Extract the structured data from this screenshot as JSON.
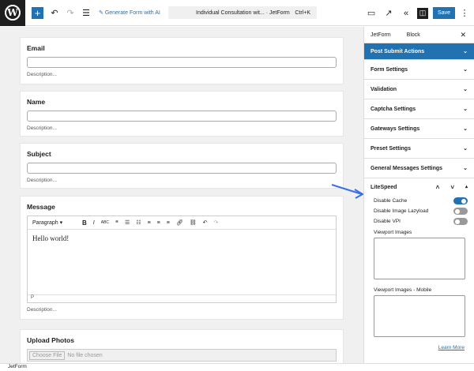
{
  "toolbar": {
    "generate": "Generate Form with AI",
    "doc_title": "Individual Consultation wit...",
    "post_type": "· JetForm",
    "shortcut": "Ctrl+K",
    "save": "Save"
  },
  "fields": [
    {
      "label": "Email",
      "description": "Description..."
    },
    {
      "label": "Name",
      "description": "Description..."
    },
    {
      "label": "Subject",
      "description": "Description..."
    },
    {
      "label": "Message",
      "description": "Description...",
      "format": "Paragraph",
      "content": "Hello world!",
      "path": "P"
    },
    {
      "label": "Upload Photos",
      "file_button": "Choose File",
      "file_status": "No file chosen"
    }
  ],
  "sidebar": {
    "tabs": [
      "JetForm",
      "Block"
    ],
    "panels": [
      "Post Submit Actions",
      "Form Settings",
      "Validation",
      "Captcha Settings",
      "Gateways Settings",
      "Preset Settings",
      "General Messages Settings"
    ],
    "litespeed": {
      "title": "LiteSpeed",
      "options": [
        {
          "label": "Disable Cache",
          "on": true
        },
        {
          "label": "Disable Image Lazyload",
          "on": false
        },
        {
          "label": "Disable VPI",
          "on": false
        }
      ],
      "viewport": "Viewport Images",
      "viewport_mobile": "Viewport Images - Mobile",
      "learn_more": "Learn More"
    }
  },
  "footer": {
    "breadcrumb": "JetForm"
  },
  "colors": {
    "accent": "#2271b1",
    "arrow": "#3a6fe6"
  }
}
